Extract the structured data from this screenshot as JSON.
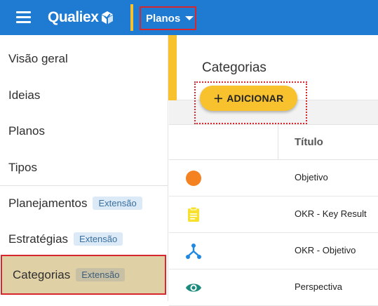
{
  "topbar": {
    "brand": "Qualiex",
    "menu_icon": "hamburger-menu-icon",
    "dropdown_label": "Planos",
    "colors": {
      "bar": "#1f7ad1",
      "accent": "#f7c22d",
      "highlight": "#d8262f"
    }
  },
  "sidebar": {
    "items": [
      {
        "label": "Visão geral"
      },
      {
        "label": "Ideias"
      },
      {
        "label": "Planos"
      },
      {
        "label": "Tipos"
      },
      {
        "label": "Planejamentos",
        "badge": "Extensão"
      },
      {
        "label": "Estratégias",
        "badge": "Extensão"
      },
      {
        "label": "Categorias",
        "badge": "Extensão",
        "active": true
      }
    ]
  },
  "main": {
    "title": "Categorias",
    "add_button": "ADICIONAR",
    "table": {
      "columns": [
        "",
        "Título"
      ],
      "rows": [
        {
          "icon": "circle-icon",
          "icon_color": "#f58220",
          "title": "Objetivo"
        },
        {
          "icon": "clipboard-icon",
          "icon_color": "#f7e12d",
          "title": "OKR - Key Result"
        },
        {
          "icon": "hierarchy-icon",
          "icon_color": "#1e88e5",
          "title": "OKR - Objetivo"
        },
        {
          "icon": "eye-icon",
          "icon_color": "#1a8a7c",
          "title": "Perspectiva"
        }
      ]
    }
  }
}
